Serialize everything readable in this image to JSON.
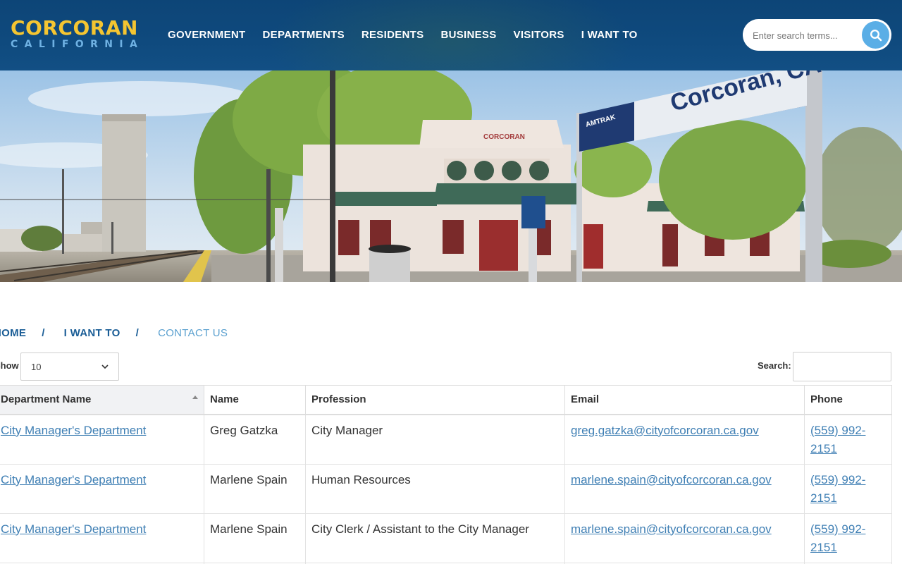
{
  "header": {
    "logo_main": "CORCORAN",
    "logo_sub": "CALIFORNIA",
    "nav": [
      "GOVERNMENT",
      "DEPARTMENTS",
      "RESIDENTS",
      "BUSINESS",
      "VISITORS",
      "I WANT TO"
    ],
    "search_placeholder": "Enter search terms..."
  },
  "hero": {
    "sign_text": "Corcoran, CA",
    "building_text": "CORCORAN",
    "sign_brand": "AMTRAK"
  },
  "breadcrumb": {
    "home": "HOME",
    "parent": "I WANT TO",
    "current": "CONTACT US",
    "separator": "/"
  },
  "table_controls": {
    "show_label": "Show",
    "show_value": "10",
    "search_label": "Search:"
  },
  "table": {
    "columns": [
      "Department Name",
      "Name",
      "Profession",
      "Email",
      "Phone"
    ],
    "rows": [
      {
        "department": "City Manager's Department",
        "name": "Greg Gatzka",
        "profession": "City Manager",
        "email": "greg.gatzka@cityofcorcoran.ca.gov",
        "phone_line1": "(559) 992-",
        "phone_line2": "2151"
      },
      {
        "department": "City Manager's Department",
        "name": "Marlene Spain",
        "profession": "Human Resources",
        "email": "marlene.spain@cityofcorcoran.ca.gov",
        "phone_line1": "(559) 992-",
        "phone_line2": "2151"
      },
      {
        "department": "City Manager's Department",
        "name": "Marlene Spain",
        "profession": "City Clerk / Assistant to the City Manager",
        "email": "marlene.spain@cityofcorcoran.ca.gov",
        "phone_line1": "(559) 992-",
        "phone_line2": "2151"
      }
    ]
  },
  "colors": {
    "header_bg": "#0f4a7e",
    "logo_yellow": "#f4c531",
    "logo_blue": "#6fb1e3",
    "search_button": "#5aaee6",
    "link": "#3f7fb4"
  }
}
